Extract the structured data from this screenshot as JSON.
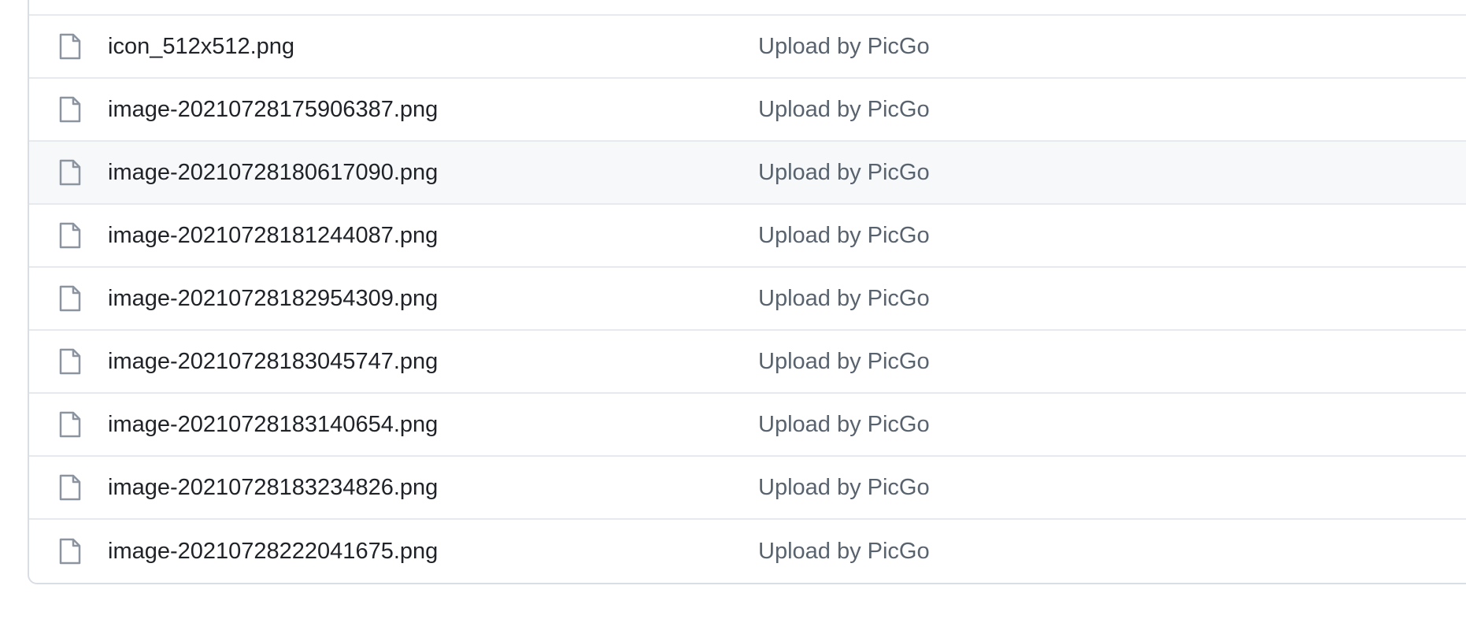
{
  "files": [
    {
      "name": "icon_512x512.png",
      "commit_message": "Upload by PicGo"
    },
    {
      "name": "image-20210728175906387.png",
      "commit_message": "Upload by PicGo"
    },
    {
      "name": "image-20210728180617090.png",
      "commit_message": "Upload by PicGo",
      "hover": true
    },
    {
      "name": "image-20210728181244087.png",
      "commit_message": "Upload by PicGo"
    },
    {
      "name": "image-20210728182954309.png",
      "commit_message": "Upload by PicGo"
    },
    {
      "name": "image-20210728183045747.png",
      "commit_message": "Upload by PicGo"
    },
    {
      "name": "image-20210728183140654.png",
      "commit_message": "Upload by PicGo"
    },
    {
      "name": "image-20210728183234826.png",
      "commit_message": "Upload by PicGo"
    },
    {
      "name": "image-20210728222041675.png",
      "commit_message": "Upload by PicGo"
    }
  ],
  "icons": {
    "file": "file-icon"
  },
  "colors": {
    "name_text": "#1f2328",
    "commit_text": "#59636e",
    "icon": "#8c959f",
    "border": "#d8dee4",
    "row_hover": "#f6f8fa"
  }
}
